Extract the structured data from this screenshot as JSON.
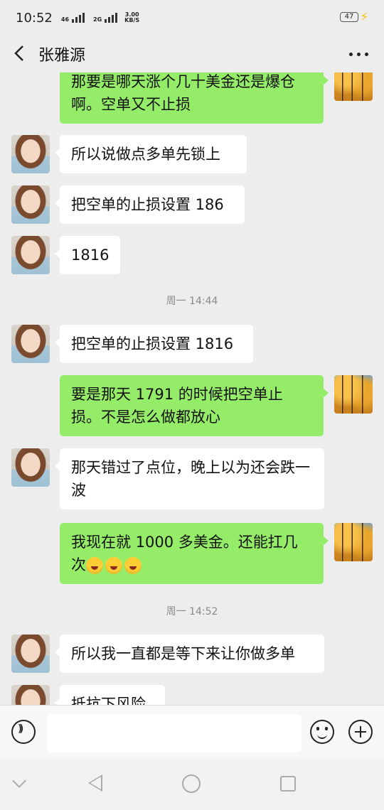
{
  "status_bar": {
    "time": "10:52",
    "signal1": "46",
    "signal2": "2G",
    "speed_value": "3.00",
    "speed_unit": "KB/S",
    "battery": "47"
  },
  "header": {
    "title": "张雅源"
  },
  "messages": [
    {
      "from": "me",
      "text": "那要是哪天涨个几十美金还是爆仓啊。空单又不止损"
    },
    {
      "from": "contact",
      "text": "所以说做点多单先锁上"
    },
    {
      "from": "contact",
      "text": "把空单的止损设置 186"
    },
    {
      "from": "contact",
      "text": "1816"
    },
    {
      "timestamp": "周一 14:44"
    },
    {
      "from": "contact",
      "text": "把空单的止损设置 1816"
    },
    {
      "from": "me",
      "text": "要是那天 1791 的时候把空单止损。不是怎么做都放心"
    },
    {
      "from": "contact",
      "text": "那天错过了点位，晚上以为还会跌一波"
    },
    {
      "from": "me",
      "text": "我现在就 1000 多美金。还能扛几次",
      "emoji_count": 3,
      "emoji": "rolling-on-floor-laughing"
    },
    {
      "timestamp": "周一 14:52"
    },
    {
      "from": "contact",
      "text": "所以我一直都是等下来让你做多单"
    },
    {
      "from": "contact",
      "text": "抵抗下风险"
    }
  ],
  "colors": {
    "my_bubble": "#95ec69",
    "their_bubble": "#ffffff",
    "background": "#ededed"
  }
}
